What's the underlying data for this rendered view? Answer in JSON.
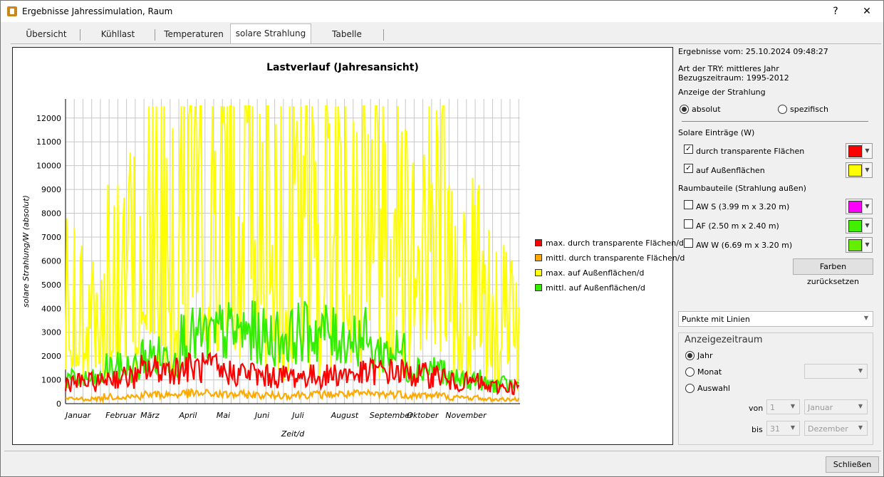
{
  "window": {
    "title": "Ergebnisse Jahressimulation, Raum",
    "help": "?",
    "close": "✕"
  },
  "tabs": [
    "Übersicht",
    "Kühllast",
    "Temperaturen",
    "solare Strahlung",
    "Tabelle"
  ],
  "active_tab": "solare Strahlung",
  "info": {
    "results_date": "Ergebnisse vom: 25.10.2024 09:48:27",
    "try_type": "Art der TRY: mittleres Jahr",
    "reference_period": "Bezugszeitraum: 1995-2012"
  },
  "display": {
    "heading": "Anzeige der Strahlung",
    "absolute": "absolut",
    "specific": "spezifisch",
    "selected": "absolut"
  },
  "solar_inputs": {
    "heading": "Solare Einträge (W)",
    "items": [
      {
        "label": "durch transparente Flächen",
        "checked": true,
        "color": "#ff0000"
      },
      {
        "label": "auf Außenflächen",
        "checked": true,
        "color": "#ffff00"
      }
    ]
  },
  "components": {
    "heading": "Raumbauteile (Strahlung außen)",
    "items": [
      {
        "label": "AW S (3.99 m x 3.20 m)",
        "checked": false,
        "color": "#ff00ff"
      },
      {
        "label": "AF (2.50 m x 2.40 m)",
        "checked": false,
        "color": "#44ee00"
      },
      {
        "label": "AW W (6.69 m x 3.20 m)",
        "checked": false,
        "color": "#66ee00"
      }
    ]
  },
  "reset_colors": "Farben zurücksetzen",
  "plot_style": "Punkte mit Linien",
  "period": {
    "heading": "Anzeigezeitraum",
    "year": "Jahr",
    "month": "Monat",
    "custom": "Auswahl",
    "selected": "Jahr",
    "from_label": "von",
    "to_label": "bis",
    "from_day": "1",
    "from_month": "Januar",
    "to_day": "31",
    "to_month": "Dezember"
  },
  "close_button": "Schließen",
  "chart_data": {
    "type": "line",
    "title": "Lastverlauf (Jahresansicht)",
    "xlabel": "Zeit/d",
    "ylabel": "solare Strahlung/W (absolut)",
    "ylim": [
      0,
      12800
    ],
    "yticks": [
      0,
      1000,
      2000,
      3000,
      4000,
      5000,
      6000,
      7000,
      8000,
      9000,
      10000,
      11000,
      12000
    ],
    "month_labels": [
      "Januar",
      "Februar",
      "März",
      "April",
      "Mai",
      "Juni",
      "Juli",
      "August",
      "September",
      "Oktober",
      "November"
    ],
    "grid": true,
    "legend_position": "right",
    "series": [
      {
        "name": "max. durch transparente Flächen/d",
        "color": "#ff0000",
        "monthly_values": [
          900,
          1100,
          1450,
          1500,
          1300,
          1150,
          1150,
          1250,
          1350,
          1200,
          900,
          700
        ]
      },
      {
        "name": "mittl. durch transparente Flächen/d",
        "color": "#ffaa00",
        "monthly_values": [
          200,
          300,
          380,
          420,
          380,
          350,
          380,
          400,
          400,
          350,
          250,
          180
        ]
      },
      {
        "name": "max. auf Außenflächen/d",
        "color": "#ffff00",
        "monthly_values": [
          4500,
          6500,
          9000,
          10000,
          10500,
          9500,
          9500,
          10500,
          9500,
          8000,
          6000,
          4500
        ]
      },
      {
        "name": "mittl. auf Außenflächen/d",
        "color": "#33ee00",
        "monthly_values": [
          1000,
          1500,
          2000,
          2800,
          3000,
          2800,
          3000,
          2800,
          2200,
          1500,
          1000,
          800
        ]
      }
    ]
  }
}
